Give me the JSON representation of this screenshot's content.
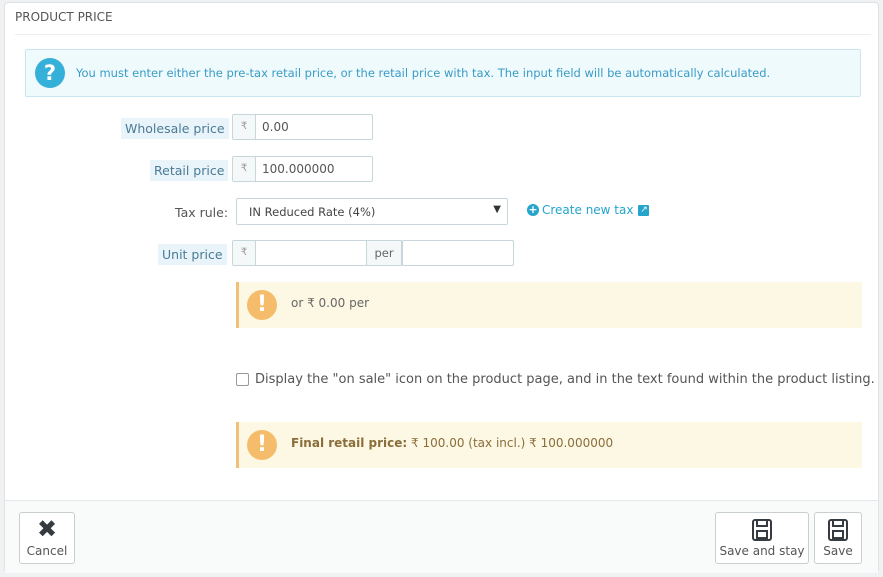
{
  "panel": {
    "title": "PRODUCT PRICE"
  },
  "info": {
    "icon": "question-icon",
    "text": "You must enter either the pre-tax retail price, or the retail price with tax. The input field will be automatically calculated."
  },
  "fields": {
    "wholesale_label": "Wholesale price",
    "wholesale_value": "0.00",
    "retail_label": "Retail price",
    "retail_value": "100.000000",
    "tax_label": "Tax rule:",
    "tax_value": "IN Reduced Rate (4%)",
    "create_tax_link": "Create new tax",
    "unit_label": "Unit price",
    "unit_value": "",
    "unit_per_label": "per",
    "unit_per_value": "",
    "currency_symbol": "₹"
  },
  "unit_warning": {
    "text": "or ₹ 0.00 per"
  },
  "on_sale": {
    "label": "Display the \"on sale\" icon on the product page, and in the text found within the product listing."
  },
  "final_price": {
    "label": "Final retail price:",
    "value": "₹ 100.00 (tax incl.) ₹ 100.000000"
  },
  "footer": {
    "cancel_label": "Cancel",
    "save_stay_label": "Save and stay",
    "save_label": "Save"
  }
}
